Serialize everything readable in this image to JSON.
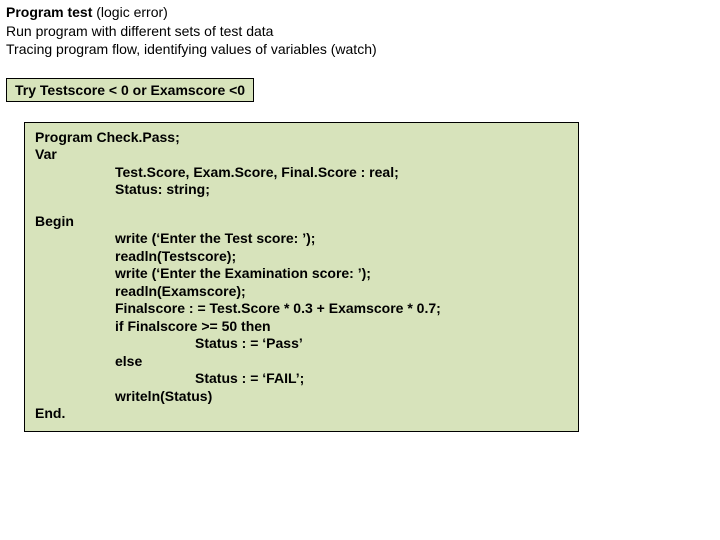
{
  "header": {
    "title_bold": "Program test ",
    "title_rest": "(logic error)",
    "line2": "Run program with different sets of test data",
    "line3": "Tracing program flow, identifying values of variables (watch)"
  },
  "hint": "Try Testscore  < 0 or Examscore <0",
  "code": {
    "l1": "Program Check.Pass;",
    "l2": "Var",
    "l3": "Test.Score, Exam.Score, Final.Score : real;",
    "l4": "Status: string;",
    "l5": "Begin",
    "l6": "write (‘Enter the Test score: ’);",
    "l7": "readln(Testscore);",
    "l8": "write (‘Enter the Examination score: ’);",
    "l9": "readln(Examscore);",
    "l10": "Finalscore : = Test.Score * 0.3 + Examscore * 0.7;",
    "l11": "if Finalscore >= 50 then",
    "l12": "Status : = ‘Pass’",
    "l13": "else",
    "l14": "Status : = ‘FAIL’;",
    "l15": "writeln(Status)",
    "l16": "End."
  }
}
